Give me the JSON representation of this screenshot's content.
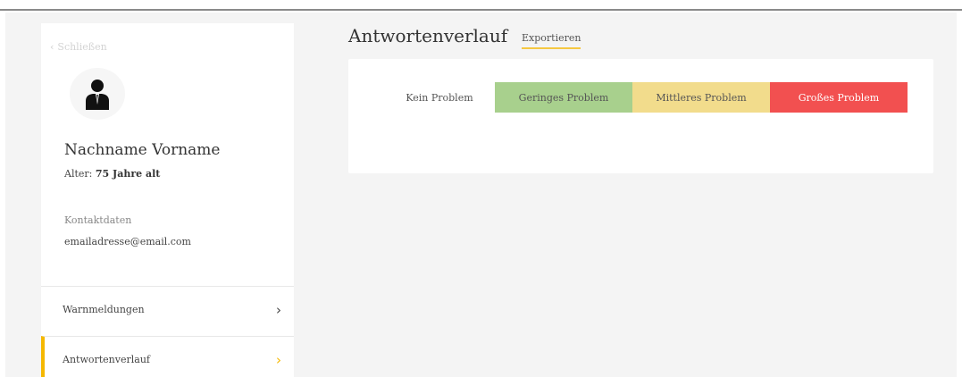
{
  "sidebar": {
    "back_label": "Schließen",
    "profile": {
      "name": "Nachname Vorname",
      "age_label": "Alter:",
      "age_value": "75 Jahre alt",
      "contact_label": "Kontaktdaten",
      "email": "emailadresse@email.com"
    },
    "nav": [
      {
        "label": "Warnmeldungen",
        "icon": "chevron-right-icon",
        "active": false
      },
      {
        "label": "Antwortenverlauf",
        "icon": "chevron-right-icon",
        "active": true
      }
    ]
  },
  "main": {
    "title": "Antwortenverlauf",
    "export_label": "Exportieren",
    "legend": [
      {
        "label": "Kein Problem",
        "color": "#ffffff"
      },
      {
        "label": "Geringes Problem",
        "color": "#a8d08d"
      },
      {
        "label": "Mittleres Problem",
        "color": "#f2dc8c"
      },
      {
        "label": "Großes Problem",
        "color": "#f25050"
      }
    ]
  },
  "colors": {
    "accent": "#f5b800",
    "background": "#f4f4f4"
  }
}
